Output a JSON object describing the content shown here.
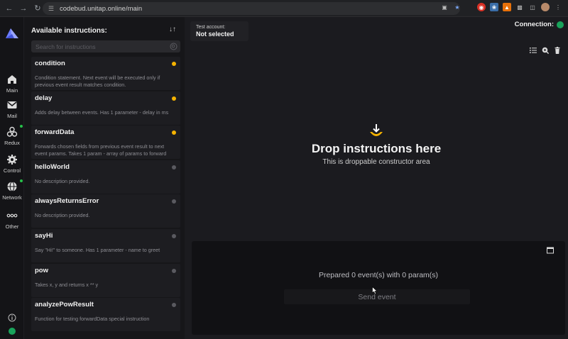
{
  "browser": {
    "url": "codebud.unitap.online/main"
  },
  "rail": {
    "items": [
      {
        "label": "Main",
        "icon": "home-icon"
      },
      {
        "label": "Mail",
        "icon": "mail-icon"
      },
      {
        "label": "Redux",
        "icon": "redux-icon"
      },
      {
        "label": "Control",
        "icon": "gear-icon"
      },
      {
        "label": "Network",
        "icon": "globe-icon"
      },
      {
        "label": "Other",
        "icon": "more-icon"
      }
    ]
  },
  "instructions": {
    "title": "Available instructions:",
    "search_placeholder": "Search for instructions",
    "items": [
      {
        "name": "condition",
        "desc": "Condition statement. Next event will be executed only if previous event result matches condition.",
        "status": "special"
      },
      {
        "name": "delay",
        "desc": "Adds delay between events. Has 1 parameter - delay in ms",
        "status": "special"
      },
      {
        "name": "forwardData",
        "desc": "Forwards chosen fields from previous event result to next event params. Takes 1 param - array of params to forward",
        "status": "special"
      },
      {
        "name": "helloWorld",
        "desc": "No description provided.",
        "status": "normal"
      },
      {
        "name": "alwaysReturnsError",
        "desc": "No description provided.",
        "status": "normal"
      },
      {
        "name": "sayHi",
        "desc": "Say \"Hi!\" to someone. Has 1 parameter - name to greet",
        "status": "normal"
      },
      {
        "name": "pow",
        "desc": "Takes x, y and returns x ** y",
        "status": "normal"
      },
      {
        "name": "analyzePowResult",
        "desc": "Function for testing forwardData special instruction",
        "status": "normal"
      }
    ]
  },
  "test_account": {
    "label": "Test account:",
    "value": "Not selected"
  },
  "connection": {
    "label": "Connection:",
    "status_color": "#19a35b"
  },
  "drop_area": {
    "title": "Drop instructions here",
    "subtitle": "This is droppable constructor area"
  },
  "bottom": {
    "prepared": "Prepared 0 event(s) with 0 param(s)",
    "send_label": "Send event"
  },
  "colors": {
    "special_dot": "#f5b301",
    "normal_dot": "#5a5a60",
    "accent": "#f5b301",
    "online": "#27c04a"
  }
}
